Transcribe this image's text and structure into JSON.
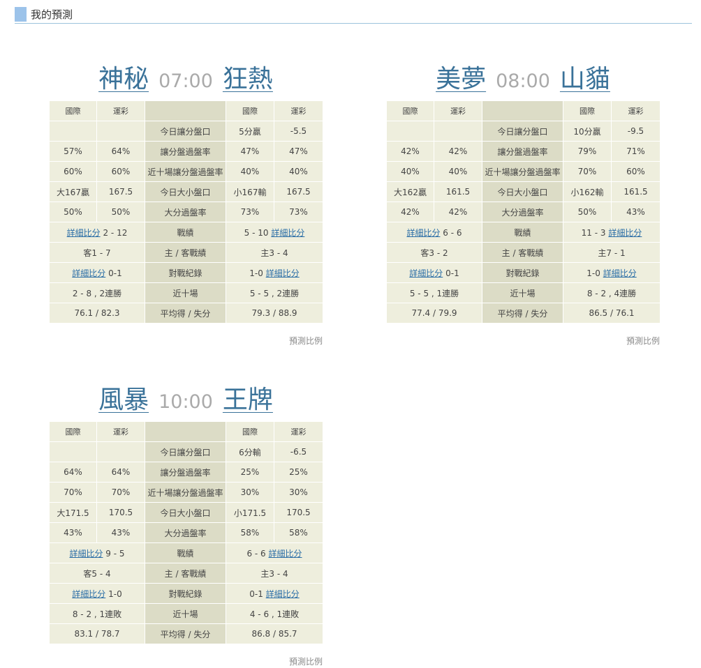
{
  "header": {
    "title": "我的預測"
  },
  "labels": {
    "col_intl": "國際",
    "col_sport": "運彩",
    "detail_link": "詳細比分",
    "prediction_ratio": "預測比例",
    "rows": [
      "今日讓分盤口",
      "讓分盤過盤率",
      "近十場讓分盤過盤率",
      "今日大小盤口",
      "大分過盤率",
      "戰績",
      "主 / 客戰績",
      "對戰紀錄",
      "近十場",
      "平均得 / 失分"
    ]
  },
  "matches": [
    {
      "home": "神秘",
      "time": "07:00",
      "away": "狂熱",
      "left": {
        "spread": [
          "",
          ""
        ],
        "spread_rate": [
          "57%",
          "64%"
        ],
        "spread_rate10": [
          "60%",
          "60%"
        ],
        "total": [
          "大167贏",
          "167.5"
        ],
        "over_rate": [
          "50%",
          "50%"
        ],
        "record": "2 - 12",
        "home_away": "客1 - 7",
        "h2h": "0-1",
        "last10": "2 - 8 , 2連勝",
        "avg": "76.1 / 82.3"
      },
      "right": {
        "spread": [
          "5分贏",
          "-5.5"
        ],
        "spread_rate": [
          "47%",
          "47%"
        ],
        "spread_rate10": [
          "40%",
          "40%"
        ],
        "total": [
          "小167輸",
          "167.5"
        ],
        "over_rate": [
          "73%",
          "73%"
        ],
        "record": "5 - 10",
        "home_away": "主3 - 4",
        "h2h": "1-0",
        "last10": "5 - 5 , 2連勝",
        "avg": "79.3 / 88.9"
      }
    },
    {
      "home": "美夢",
      "time": "08:00",
      "away": "山貓",
      "left": {
        "spread": [
          "",
          ""
        ],
        "spread_rate": [
          "42%",
          "42%"
        ],
        "spread_rate10": [
          "40%",
          "40%"
        ],
        "total": [
          "大162贏",
          "161.5"
        ],
        "over_rate": [
          "42%",
          "42%"
        ],
        "record": "6 - 6",
        "home_away": "客3 - 2",
        "h2h": "0-1",
        "last10": "5 - 5 , 1連勝",
        "avg": "77.4 / 79.9"
      },
      "right": {
        "spread": [
          "10分贏",
          "-9.5"
        ],
        "spread_rate": [
          "79%",
          "71%"
        ],
        "spread_rate10": [
          "70%",
          "60%"
        ],
        "total": [
          "小162輸",
          "161.5"
        ],
        "over_rate": [
          "50%",
          "43%"
        ],
        "record": "11 - 3",
        "home_away": "主7 - 1",
        "h2h": "1-0",
        "last10": "8 - 2 , 4連勝",
        "avg": "86.5 / 76.1"
      }
    },
    {
      "home": "風暴",
      "time": "10:00",
      "away": "王牌",
      "left": {
        "spread": [
          "",
          ""
        ],
        "spread_rate": [
          "64%",
          "64%"
        ],
        "spread_rate10": [
          "70%",
          "70%"
        ],
        "total": [
          "大171.5",
          "170.5"
        ],
        "over_rate": [
          "43%",
          "43%"
        ],
        "record": "9 - 5",
        "home_away": "客5 - 4",
        "h2h": "1-0",
        "last10": "8 - 2 , 1連敗",
        "avg": "83.1 / 78.7"
      },
      "right": {
        "spread": [
          "6分輸",
          "-6.5"
        ],
        "spread_rate": [
          "25%",
          "25%"
        ],
        "spread_rate10": [
          "30%",
          "30%"
        ],
        "total": [
          "小171.5",
          "170.5"
        ],
        "over_rate": [
          "58%",
          "58%"
        ],
        "record": "6 - 6",
        "home_away": "主3 - 4",
        "h2h": "0-1",
        "last10": "4 - 6 , 1連敗",
        "avg": "86.8 / 85.7"
      }
    }
  ]
}
